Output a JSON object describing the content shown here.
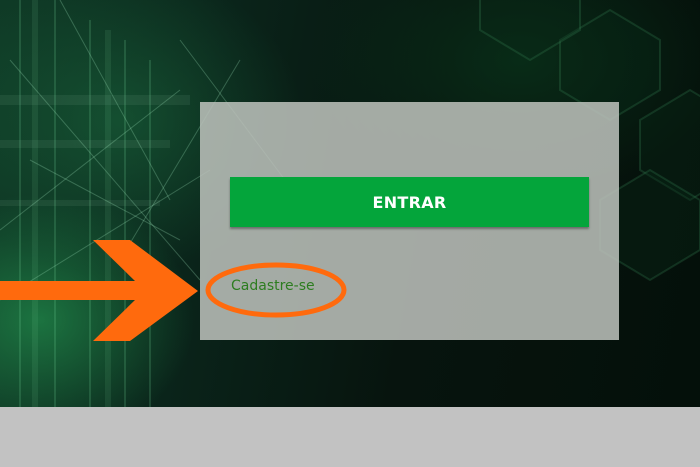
{
  "login": {
    "enter_label": "ENTRAR",
    "signup_label": "Cadastre-se"
  },
  "colors": {
    "button_green": "#04a53b",
    "link_green": "#2d7d20",
    "annotation_orange": "#ff6a0d",
    "card_background": "#bec2bd"
  },
  "annotations": {
    "arrow_icon": "right-arrow",
    "highlight_icon": "ellipse-highlight"
  }
}
